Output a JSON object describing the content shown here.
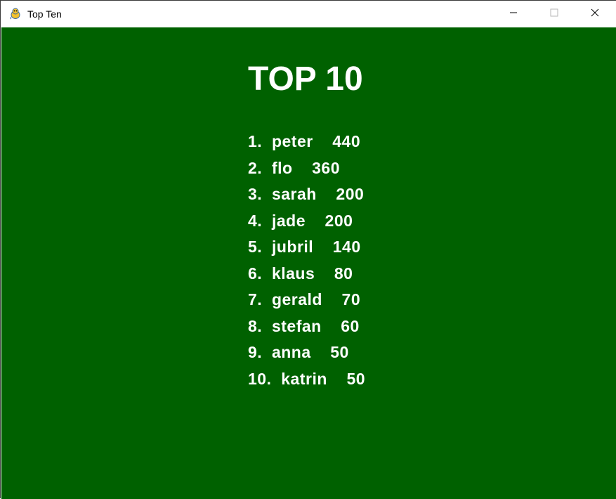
{
  "window": {
    "title": "Top Ten",
    "icon": "pygame-snake-icon",
    "controls": {
      "minimize": "minimize-icon",
      "maximize": "maximize-icon",
      "close": "close-icon"
    }
  },
  "colors": {
    "background": "#006100",
    "text": "#ffffff"
  },
  "scoreboard": {
    "heading": "TOP 10",
    "entries": [
      {
        "text": "1.  peter    440"
      },
      {
        "text": "2.  flo    360"
      },
      {
        "text": "3.  sarah    200"
      },
      {
        "text": "4.  jade    200"
      },
      {
        "text": "5.  jubril    140"
      },
      {
        "text": "6.  klaus    80"
      },
      {
        "text": "7.  gerald    70"
      },
      {
        "text": "8.  stefan    60"
      },
      {
        "text": "9.  anna    50"
      },
      {
        "text": "10.  katrin    50"
      }
    ]
  }
}
